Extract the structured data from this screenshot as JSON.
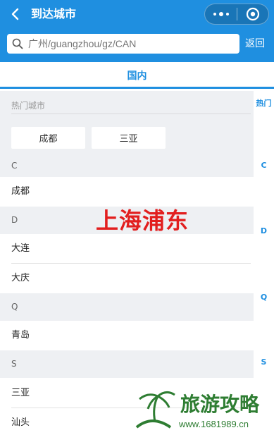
{
  "header": {
    "title": "到达城市",
    "search_placeholder": "广州/guangzhou/gz/CAN",
    "return_label": "返回",
    "icons": [
      "chevron-left-icon",
      "more-icon",
      "target-icon",
      "search-icon"
    ],
    "colors": {
      "primary": "#1f8fe0",
      "overlay_red": "#e21e1e",
      "watermark_green": "#2e7d32"
    }
  },
  "tabs": [
    {
      "label": "国内"
    }
  ],
  "hot": {
    "label": "热门城市",
    "cities": [
      "成都",
      "三亚"
    ]
  },
  "groups": [
    {
      "letter": "C",
      "cities": [
        "成都"
      ]
    },
    {
      "letter": "D",
      "cities": [
        "大连",
        "大庆"
      ]
    },
    {
      "letter": "Q",
      "cities": [
        "青岛"
      ]
    },
    {
      "letter": "S",
      "cities": [
        "三亚",
        "汕头"
      ]
    }
  ],
  "index_bar": [
    "热门",
    "C",
    "D",
    "Q",
    "S"
  ],
  "overlay": {
    "text": "上海浦东"
  },
  "watermark": {
    "title": "旅游攻略",
    "url": "www.1681989.cn"
  }
}
